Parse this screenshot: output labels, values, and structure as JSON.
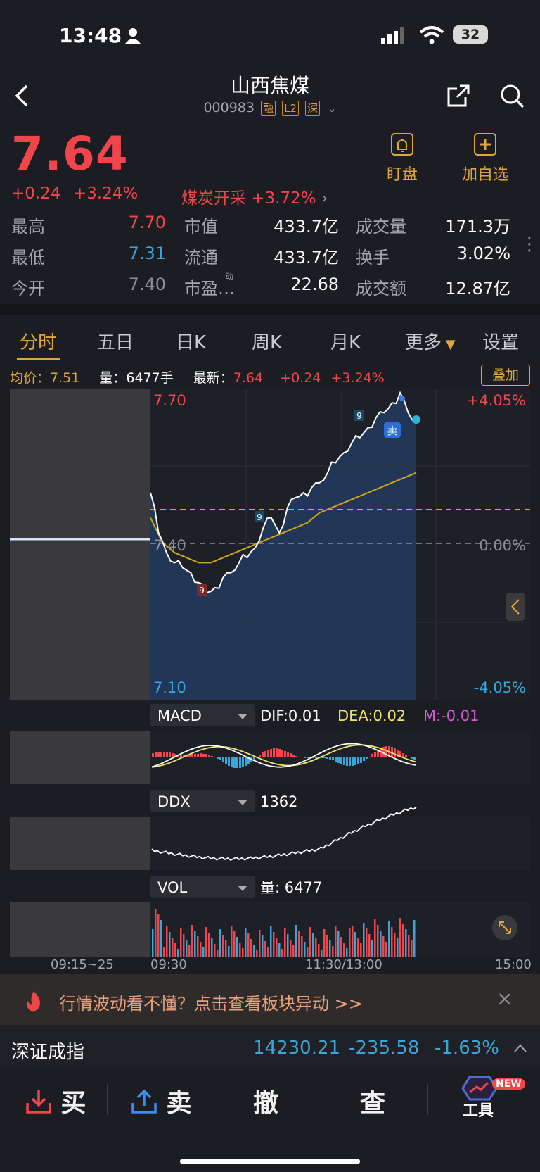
{
  "status": {
    "time": "13:48",
    "battery": "32"
  },
  "header": {
    "title": "山西焦煤",
    "code": "000983",
    "tags": [
      "融",
      "L2",
      "深"
    ]
  },
  "actions": {
    "watch_label": "盯盘",
    "add_label": "加自选"
  },
  "quote": {
    "price": "7.64",
    "change": "+0.24",
    "change_pct": "+3.24%",
    "sector_name": "煤炭开采",
    "sector_pct": "+3.72%"
  },
  "stats": {
    "high_label": "最高",
    "high": "7.70",
    "low_label": "最低",
    "low": "7.31",
    "open_label": "今开",
    "open": "7.40",
    "mcap_label": "市值",
    "mcap": "433.7亿",
    "float_label": "流通",
    "float": "433.7亿",
    "pe_label": "市盈…",
    "pe_sup": "动",
    "pe": "22.68",
    "vol_label": "成交量",
    "vol": "171.3万",
    "turn_label": "换手",
    "turn": "3.02%",
    "amt_label": "成交额",
    "amt": "12.87亿"
  },
  "tabs": [
    "分时",
    "五日",
    "日K",
    "周K",
    "月K",
    "更多",
    "设置"
  ],
  "legend": {
    "avg_label": "均价：",
    "avg": "7.51",
    "qty_label": "量：",
    "qty": "6477手",
    "latest_label": "最新：",
    "latest": "7.64",
    "latest_chg": "+0.24",
    "latest_pct": "+3.24%",
    "overlay": "叠加"
  },
  "chart_data": {
    "type": "line",
    "y_top_label": "7.70",
    "y_mid_label": "7.40",
    "y_bottom_label": "7.10",
    "pct_top": "+4.05%",
    "pct_mid": "0.00%",
    "pct_bottom": "-4.05%",
    "ylim": [
      7.1,
      7.7
    ],
    "prev_close": 7.4,
    "x_labels": [
      "09:15~25",
      "09:30",
      "11:30/13:00",
      "15:00"
    ],
    "series": [
      {
        "values": [
          7.5,
          7.42,
          7.38,
          7.36,
          7.35,
          7.34,
          7.32,
          7.3,
          7.31,
          7.33,
          7.34,
          7.36,
          7.37,
          7.39,
          7.43,
          7.45,
          7.42,
          7.47,
          7.49,
          7.5,
          7.51,
          7.52,
          7.54,
          7.56,
          7.58,
          7.6,
          7.61,
          7.63,
          7.65,
          7.66,
          7.68,
          7.7,
          7.66,
          7.64
        ]
      },
      {
        "values": [
          7.45,
          7.4,
          7.38,
          7.37,
          7.36,
          7.36,
          7.37,
          7.38,
          7.39,
          7.4,
          7.41,
          7.42,
          7.43,
          7.44,
          7.46,
          7.47,
          7.48,
          7.49,
          7.5,
          7.51,
          7.52,
          7.53,
          7.54
        ]
      }
    ],
    "markers": [
      "9",
      "9",
      "9",
      "卖"
    ]
  },
  "indicators": {
    "macd": {
      "name": "MACD",
      "dif": "DIF:0.01",
      "dea": "DEA:0.02",
      "m": "M:-0.01"
    },
    "ddx": {
      "name": "DDX",
      "value": "1362"
    },
    "vol": {
      "name": "VOL",
      "value": "量: 6477"
    }
  },
  "banner": {
    "text": "行情波动看不懂？点击查看板块异动 >>"
  },
  "index": {
    "name": "深证成指",
    "value": "14230.21",
    "change": "-235.58",
    "pct": "-1.63%"
  },
  "bottom": {
    "buy": "买",
    "sell": "卖",
    "cancel": "撤",
    "query": "查",
    "tools": "工具",
    "new_badge": "NEW"
  },
  "colors": {
    "up": "#f0454b",
    "down": "#3aa5d8",
    "accent": "#e2a43c",
    "bg": "#1b1d22"
  }
}
